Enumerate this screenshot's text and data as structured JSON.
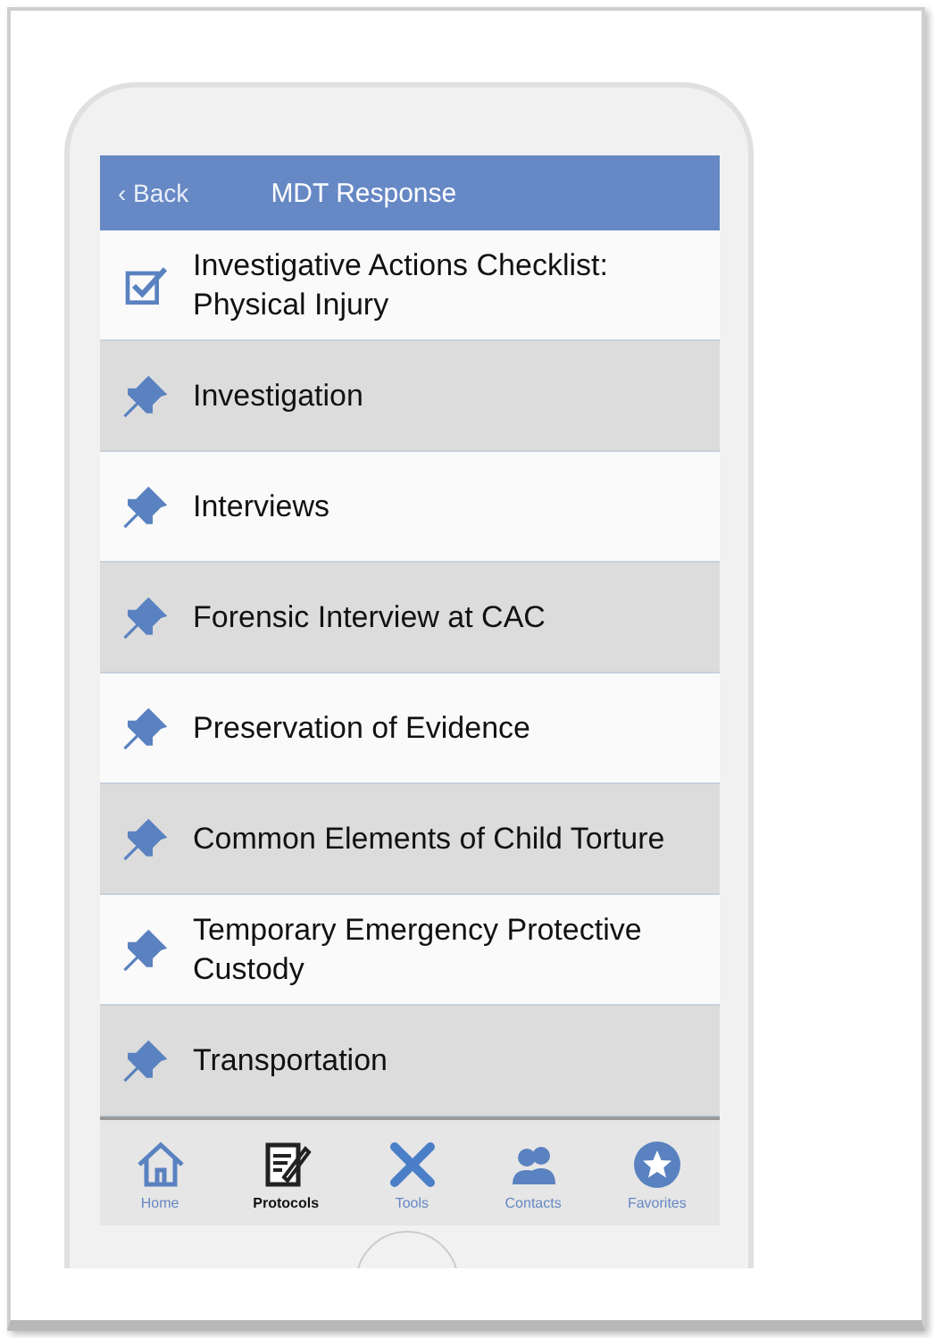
{
  "header": {
    "back": "‹ Back",
    "title": "MDT Response"
  },
  "items": [
    {
      "kind": "checklist",
      "label": "Investigative Actions Checklist: Physical Injury"
    },
    {
      "kind": "pin",
      "label": "Investigation"
    },
    {
      "kind": "pin",
      "label": "Interviews"
    },
    {
      "kind": "pin",
      "label": "Forensic Interview at CAC"
    },
    {
      "kind": "pin",
      "label": "Preservation of Evidence"
    },
    {
      "kind": "pin",
      "label": "Common Elements of Child Torture"
    },
    {
      "kind": "pin",
      "label": "Temporary Emergency Protective Custody"
    },
    {
      "kind": "pin",
      "label": "Transportation"
    }
  ],
  "tabs": [
    {
      "kind": "home",
      "label": "Home",
      "selected": false
    },
    {
      "kind": "protocols",
      "label": "Protocols",
      "selected": true
    },
    {
      "kind": "tools",
      "label": "Tools",
      "selected": false
    },
    {
      "kind": "contacts",
      "label": "Contacts",
      "selected": false
    },
    {
      "kind": "favorites",
      "label": "Favorites",
      "selected": false
    }
  ]
}
